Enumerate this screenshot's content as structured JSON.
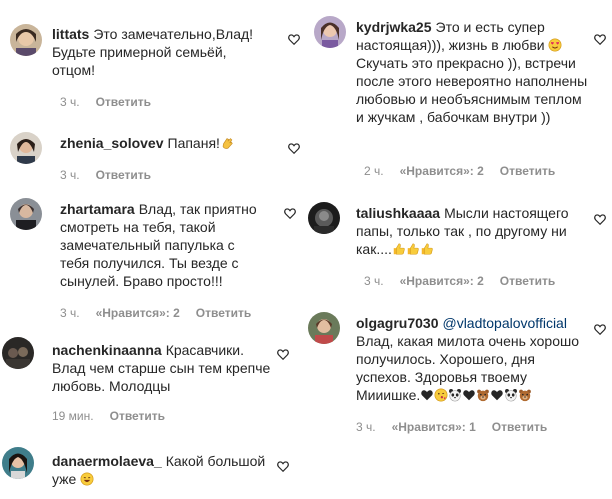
{
  "reply_label": "Ответить",
  "left_column": [
    {
      "username": "littats",
      "text": "Это замечательно,Влад! Будьте примерной семьёй, отцом!",
      "time": "3 ч.",
      "likes": ""
    },
    {
      "username": "zhenia_solovev",
      "text": "Папаня!",
      "emoji": "clap-emoji",
      "time": "3 ч.",
      "likes": ""
    },
    {
      "username": "zhartamara",
      "text": "Влад, так приятно смотреть на тебя, такой замечательный папулька с тебя получился. Ты везде с сынулей. Браво просто!!!",
      "time": "3 ч.",
      "likes": "«Нравится»: 2"
    },
    {
      "username": "nachenkinaanna",
      "text": "Красавчики. Влад чем старше сын тем крепче любовь. Молодцы",
      "time": "19 мин.",
      "likes": ""
    },
    {
      "username": "danaermolaeva_",
      "text": "Какой большой уже",
      "emoji": "laugh-emoji",
      "time": "",
      "likes": ""
    }
  ],
  "right_column": [
    {
      "username": "kydrjwka25",
      "text": "Это и есть супер настоящая))), жизнь в любви",
      "text_after_emoji": "Скучать это прекрасно )), встречи после этого невероятно наполнены любовью и необъяснимым теплом и жучкам , бабочкам внутри ))",
      "emoji": "heart-eyes-emoji",
      "time": "2 ч.",
      "likes": "«Нравится»: 2"
    },
    {
      "username": "taliushkaaaa",
      "text": "Мысли настоящего папы, только так , по другому ни как....",
      "emoji": "thumbs-up-emoji",
      "time": "3 ч.",
      "likes": "«Нравится»: 2"
    },
    {
      "username": "olgagru7030",
      "mention": "@vladtopalovofficial",
      "text": "Влад, какая милота очень хорошо получилось. Хорошего, дня успехов. Здоровья твоему Мииишке.",
      "time": "3 ч.",
      "likes": "«Нравится»: 1"
    }
  ],
  "colors": {
    "text": "#262626",
    "meta": "#8e8e8e",
    "mention": "#00376b"
  }
}
